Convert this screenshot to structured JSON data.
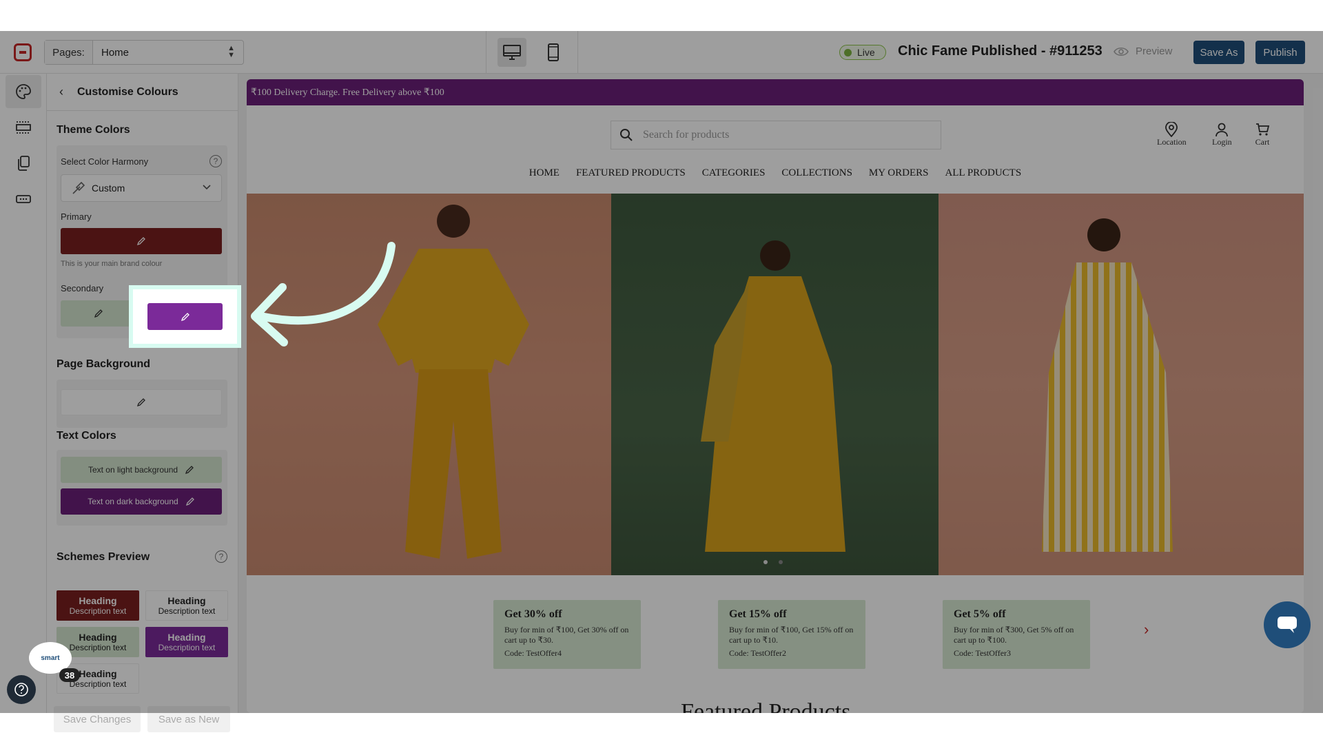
{
  "topbar": {
    "pages_label": "Pages:",
    "page_selected": "Home",
    "live_label": "Live",
    "store_title": "Chic Fame Published - #911253",
    "preview_label": "Preview",
    "save_as_label": "Save As",
    "publish_label": "Publish"
  },
  "panel": {
    "title": "Customise Colours",
    "theme_colors_title": "Theme Colors",
    "harmony_label": "Select Color Harmony",
    "harmony_value": "Custom",
    "primary_label": "Primary",
    "primary_color": "#7a1f1f",
    "primary_hint": "This is your main brand colour",
    "secondary_label": "Secondary",
    "secondary_color_1": "#d4e6cf",
    "secondary_color_2": "#7b2a99",
    "page_background_title": "Page Background",
    "text_colors_title": "Text Colors",
    "text_light_label": "Text on light background",
    "text_dark_label": "Text on dark background",
    "schemes_title": "Schemes Preview",
    "schemes": [
      {
        "heading": "Heading",
        "desc": "Description text"
      },
      {
        "heading": "Heading",
        "desc": "Description text"
      },
      {
        "heading": "Heading",
        "desc": "Description text"
      },
      {
        "heading": "Heading",
        "desc": "Description text"
      },
      {
        "heading": "Heading",
        "desc": "Description text"
      }
    ],
    "save_changes_label": "Save Changes",
    "save_as_new_label": "Save as New",
    "notification_count": "38",
    "smart_label": "smart"
  },
  "store": {
    "announcement": "₹100 Delivery Charge. Free Delivery above ₹100",
    "search_placeholder": "Search for products",
    "header_icons": [
      {
        "label": "Location",
        "icon": "location-pin-icon"
      },
      {
        "label": "Login",
        "icon": "user-icon"
      },
      {
        "label": "Cart",
        "icon": "cart-icon"
      }
    ],
    "nav": [
      "HOME",
      "FEATURED PRODUCTS",
      "CATEGORIES",
      "COLLECTIONS",
      "MY ORDERS",
      "ALL PRODUCTS"
    ],
    "offers": [
      {
        "title": "Get 30% off",
        "desc": "Buy for min of ₹100, Get 30% off on cart up to ₹30.",
        "code": "Code: TestOffer4"
      },
      {
        "title": "Get 15% off",
        "desc": "Buy for min of ₹100, Get 15% off on cart up to ₹10.",
        "code": "Code: TestOffer2"
      },
      {
        "title": "Get 5% off",
        "desc": "Buy for min of ₹300, Get 5% off on cart up to ₹100.",
        "code": "Code: TestOffer3"
      }
    ],
    "featured_title": "Featured Products"
  },
  "colors": {
    "brand_dark": "#1f4e79",
    "announcement_bg": "#6b1f7a",
    "highlight": "#d8fbf1"
  }
}
